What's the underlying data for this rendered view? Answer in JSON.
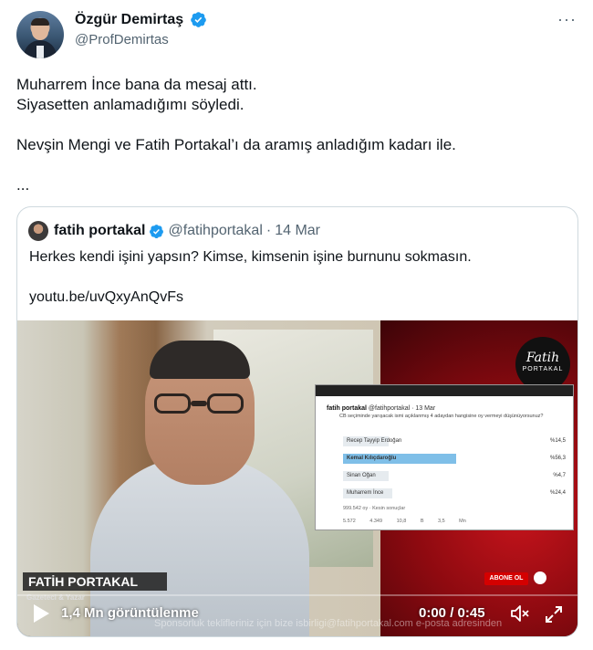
{
  "tweet": {
    "author": {
      "display_name": "Özgür Demirtaş",
      "handle": "@ProfDemirtas",
      "verified_icon": "verified-badge-icon"
    },
    "more_label": "···",
    "text_lines": [
      "Muharrem İnce bana da mesaj attı.",
      "Siyasetten anlamadığımı söyledi.",
      "Nevşin Mengi ve Fatih Portakal’ı da aramış anladığım kadarı ile.",
      "..."
    ]
  },
  "quote": {
    "author": {
      "display_name": "fatih portakal",
      "handle": "@fatihportakal",
      "separator": "·",
      "date": "14 Mar"
    },
    "text": "Herkes kendi işini yapsın? Kimse, kimsenin işine burnunu sokmasın.",
    "link": "youtu.be/uvQxyAnQvFs",
    "video": {
      "views": "1,4 Mn görüntülenme",
      "time": "0:00 / 0:45",
      "lower_third_title": "FATİH PORTAKAL",
      "lower_third_sub": "Gazeteci & Yazar",
      "subscribe_label": "ABONE OL",
      "scroll_text": "Sponsorluk teklifleriniz için bize isbirligi@fatihportakal.com e-posta adresinden",
      "logo_line1": "Fatih",
      "logo_line2": "PORTAKAL",
      "progress": 0.0,
      "poll": {
        "author": "fatih portakal",
        "handle": "@fatihportakal · 13 Mar",
        "question": "CB seçiminde yarışacak ismi açıklanmış 4 adaydan hangisine oy vermeyi düşünüyorsunuz?",
        "options": [
          {
            "label": "Recep Tayyip Erdoğan",
            "pct_label": "%14,5",
            "value": 14.5
          },
          {
            "label": "Kemal Kılıçdaroğlu",
            "pct_label": "%56,3",
            "value": 56.3
          },
          {
            "label": "Sinan Oğan",
            "pct_label": "%4,7",
            "value": 4.7
          },
          {
            "label": "Muharrem İnce",
            "pct_label": "%24,4",
            "value": 24.4
          }
        ],
        "votes": "999.542 oy · Kesin sonuçlar",
        "stats": "5.572 4.349 10,8 B 3,5 Mn"
      }
    }
  },
  "colors": {
    "verified": "#1d9bf0",
    "text_secondary": "#536471",
    "border": "#cfd9de"
  }
}
